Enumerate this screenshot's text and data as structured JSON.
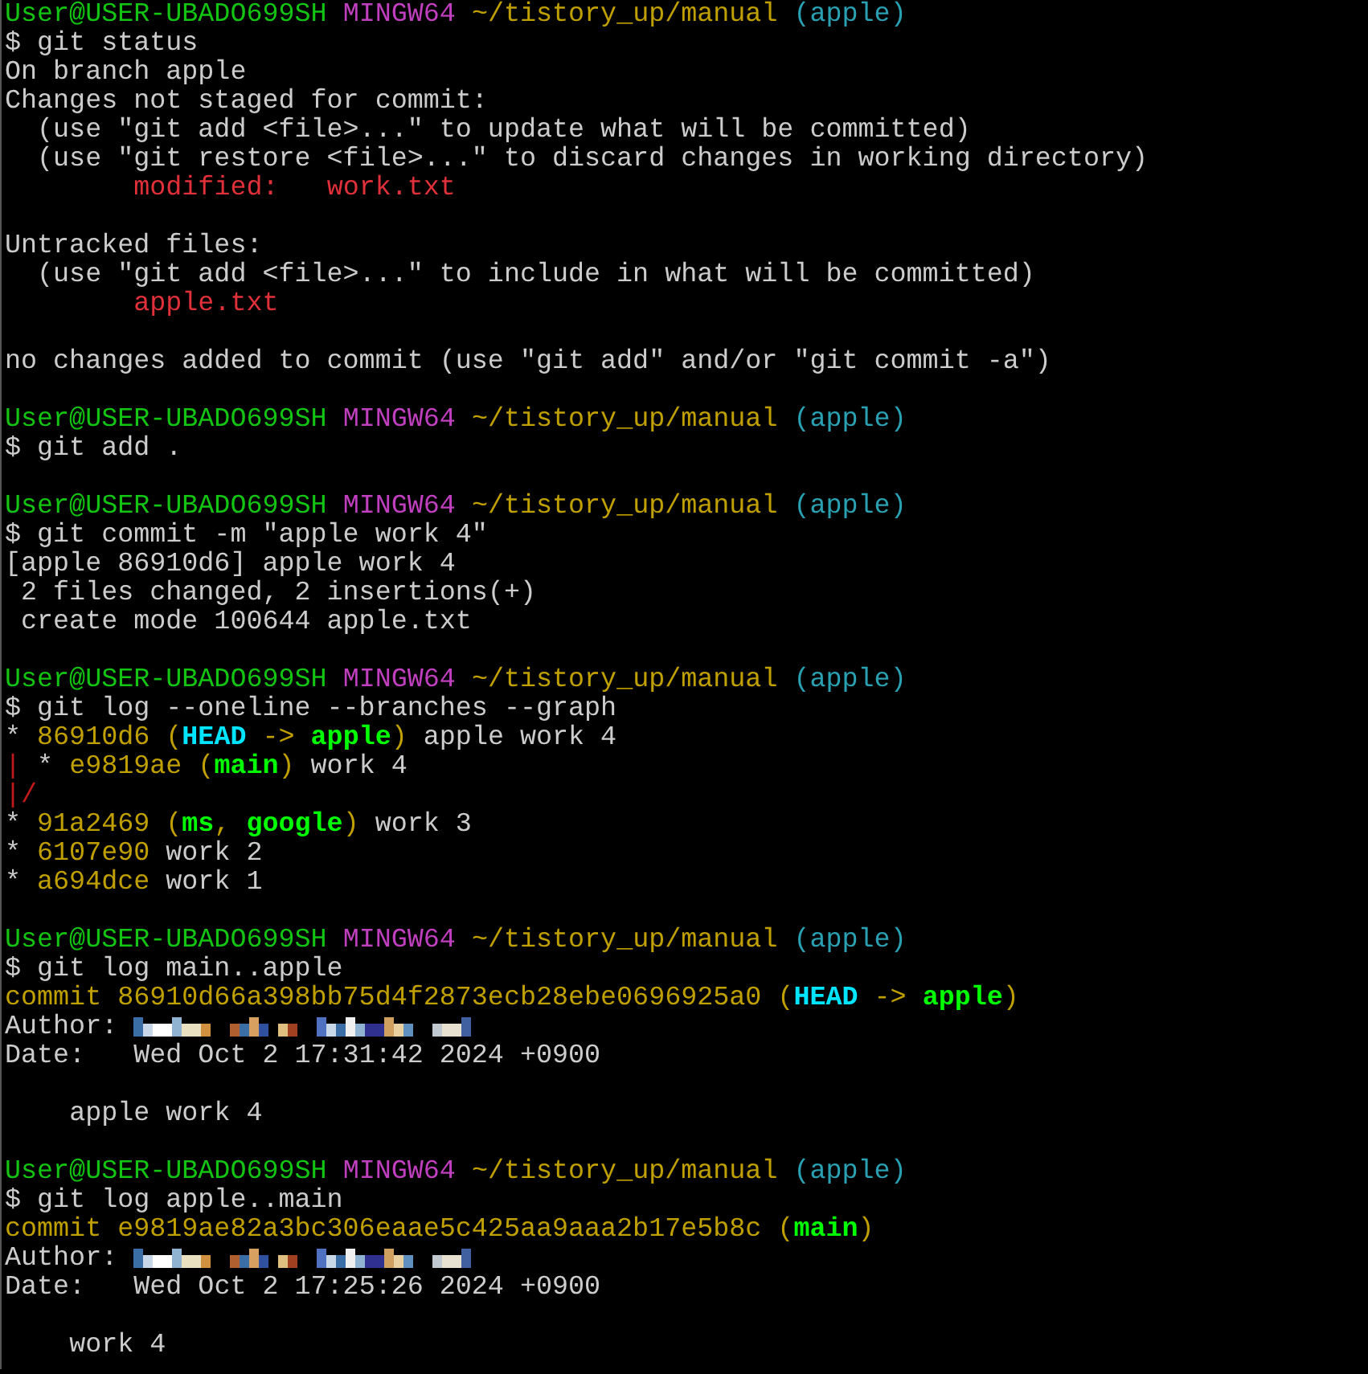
{
  "terminal": {
    "blocks": [
      {
        "lines": [
          {
            "segments": [
              {
                "kind": "user",
                "text": "User@USER-UBADO699SH"
              },
              {
                "kind": "shell",
                "text": " MINGW64"
              },
              {
                "kind": "path",
                "text": " ~/tistory_up/manual"
              },
              {
                "kind": "branch",
                "text": " (apple)"
              }
            ]
          },
          {
            "segments": [
              {
                "kind": "plain",
                "text": "$ git status"
              }
            ]
          },
          {
            "segments": [
              {
                "kind": "plain",
                "text": "On branch apple"
              }
            ]
          },
          {
            "segments": [
              {
                "kind": "plain",
                "text": "Changes not staged for commit:"
              }
            ]
          },
          {
            "segments": [
              {
                "kind": "plain",
                "text": "  (use \"git add <file>...\" to update what will be committed)"
              }
            ]
          },
          {
            "segments": [
              {
                "kind": "plain",
                "text": "  (use \"git restore <file>...\" to discard changes in working directory)"
              }
            ]
          },
          {
            "segments": [
              {
                "kind": "red",
                "text": "        modified:"
              },
              {
                "kind": "red",
                "text": "   work.txt"
              }
            ]
          }
        ]
      },
      {
        "lines": [
          {
            "segments": [
              {
                "kind": "plain",
                "text": "Untracked files:"
              }
            ]
          },
          {
            "segments": [
              {
                "kind": "plain",
                "text": "  (use \"git add <file>...\" to include in what will be committed)"
              }
            ]
          },
          {
            "segments": [
              {
                "kind": "red",
                "text": "        apple.txt"
              }
            ]
          }
        ]
      },
      {
        "lines": [
          {
            "segments": [
              {
                "kind": "plain",
                "text": "no changes added to commit (use \"git add\" and/or \"git commit -a\")"
              }
            ]
          }
        ]
      },
      {
        "lines": [
          {
            "segments": [
              {
                "kind": "user",
                "text": "User@USER-UBADO699SH"
              },
              {
                "kind": "shell",
                "text": " MINGW64"
              },
              {
                "kind": "path",
                "text": " ~/tistory_up/manual"
              },
              {
                "kind": "branch",
                "text": " (apple)"
              }
            ]
          },
          {
            "segments": [
              {
                "kind": "plain",
                "text": "$ git add ."
              }
            ]
          }
        ]
      },
      {
        "lines": [
          {
            "segments": [
              {
                "kind": "user",
                "text": "User@USER-UBADO699SH"
              },
              {
                "kind": "shell",
                "text": " MINGW64"
              },
              {
                "kind": "path",
                "text": " ~/tistory_up/manual"
              },
              {
                "kind": "branch",
                "text": " (apple)"
              }
            ]
          },
          {
            "segments": [
              {
                "kind": "plain",
                "text": "$ git commit -m \"apple work 4\""
              }
            ]
          },
          {
            "segments": [
              {
                "kind": "plain",
                "text": "[apple 86910d6] apple work 4"
              }
            ]
          },
          {
            "segments": [
              {
                "kind": "plain",
                "text": " 2 files changed, 2 insertions(+)"
              }
            ]
          },
          {
            "segments": [
              {
                "kind": "plain",
                "text": " create mode 100644 apple.txt"
              }
            ]
          }
        ]
      },
      {
        "lines": [
          {
            "segments": [
              {
                "kind": "user",
                "text": "User@USER-UBADO699SH"
              },
              {
                "kind": "shell",
                "text": " MINGW64"
              },
              {
                "kind": "path",
                "text": " ~/tistory_up/manual"
              },
              {
                "kind": "branch",
                "text": " (apple)"
              }
            ]
          },
          {
            "segments": [
              {
                "kind": "plain",
                "text": "$ git log --oneline --branches --graph"
              }
            ]
          },
          {
            "segments": [
              {
                "kind": "plain",
                "text": "*"
              },
              {
                "kind": "hash",
                "text": " 86910d6 ("
              },
              {
                "kind": "head",
                "text": "HEAD"
              },
              {
                "kind": "hash",
                "text": " ->"
              },
              {
                "kind": "ref",
                "text": " apple"
              },
              {
                "kind": "hash",
                "text": ")"
              },
              {
                "kind": "plain",
                "text": " apple work 4"
              }
            ]
          },
          {
            "segments": [
              {
                "kind": "graph",
                "text": "|"
              },
              {
                "kind": "plain",
                "text": " *"
              },
              {
                "kind": "hash",
                "text": " e9819ae ("
              },
              {
                "kind": "ref",
                "text": "main"
              },
              {
                "kind": "hash",
                "text": ")"
              },
              {
                "kind": "plain",
                "text": " work 4"
              }
            ]
          },
          {
            "segments": [
              {
                "kind": "graph",
                "text": "|/"
              }
            ]
          },
          {
            "segments": [
              {
                "kind": "plain",
                "text": "*"
              },
              {
                "kind": "hash",
                "text": " 91a2469 ("
              },
              {
                "kind": "ref",
                "text": "ms"
              },
              {
                "kind": "hash",
                "text": ","
              },
              {
                "kind": "ref",
                "text": " google"
              },
              {
                "kind": "hash",
                "text": ")"
              },
              {
                "kind": "plain",
                "text": " work 3"
              }
            ]
          },
          {
            "segments": [
              {
                "kind": "plain",
                "text": "*"
              },
              {
                "kind": "hash",
                "text": " 6107e90"
              },
              {
                "kind": "plain",
                "text": " work 2"
              }
            ]
          },
          {
            "segments": [
              {
                "kind": "plain",
                "text": "*"
              },
              {
                "kind": "hash",
                "text": " a694dce"
              },
              {
                "kind": "plain",
                "text": " work 1"
              }
            ]
          }
        ]
      },
      {
        "lines": [
          {
            "segments": [
              {
                "kind": "user",
                "text": "User@USER-UBADO699SH"
              },
              {
                "kind": "shell",
                "text": " MINGW64"
              },
              {
                "kind": "path",
                "text": " ~/tistory_up/manual"
              },
              {
                "kind": "branch",
                "text": " (apple)"
              }
            ]
          },
          {
            "segments": [
              {
                "kind": "plain",
                "text": "$ git log main..apple"
              }
            ]
          },
          {
            "segments": [
              {
                "kind": "hash",
                "text": "commit 86910d66a398bb75d4f2873ecb28ebe0696925a0 ("
              },
              {
                "kind": "head",
                "text": "HEAD"
              },
              {
                "kind": "hash",
                "text": " ->"
              },
              {
                "kind": "ref",
                "text": " apple"
              },
              {
                "kind": "hash",
                "text": ")"
              }
            ]
          },
          {
            "segments": [
              {
                "kind": "plain",
                "text": "Author:"
              },
              {
                "kind": "redacted"
              }
            ]
          },
          {
            "segments": [
              {
                "kind": "plain",
                "text": "Date:"
              },
              {
                "kind": "plain",
                "text": "   Wed Oct 2 17:31:42 2024 +0900"
              }
            ]
          }
        ]
      },
      {
        "lines": [
          {
            "segments": [
              {
                "kind": "plain",
                "text": "    apple work 4"
              }
            ]
          }
        ]
      },
      {
        "lines": [
          {
            "segments": [
              {
                "kind": "user",
                "text": "User@USER-UBADO699SH"
              },
              {
                "kind": "shell",
                "text": " MINGW64"
              },
              {
                "kind": "path",
                "text": " ~/tistory_up/manual"
              },
              {
                "kind": "branch",
                "text": " (apple)"
              }
            ]
          },
          {
            "segments": [
              {
                "kind": "plain",
                "text": "$ git log apple..main"
              }
            ]
          },
          {
            "segments": [
              {
                "kind": "hash",
                "text": "commit e9819ae82a3bc306eaae5c425aa9aaa2b17e5b8c ("
              },
              {
                "kind": "ref",
                "text": "main"
              },
              {
                "kind": "hash",
                "text": ")"
              }
            ]
          },
          {
            "segments": [
              {
                "kind": "plain",
                "text": "Author:"
              },
              {
                "kind": "redacted"
              }
            ]
          },
          {
            "segments": [
              {
                "kind": "plain",
                "text": "Date:"
              },
              {
                "kind": "plain",
                "text": "   Wed Oct 2 17:25:26 2024 +0900"
              }
            ]
          }
        ]
      },
      {
        "lines": [
          {
            "segments": [
              {
                "kind": "plain",
                "text": "    work 4"
              }
            ]
          }
        ]
      }
    ]
  }
}
